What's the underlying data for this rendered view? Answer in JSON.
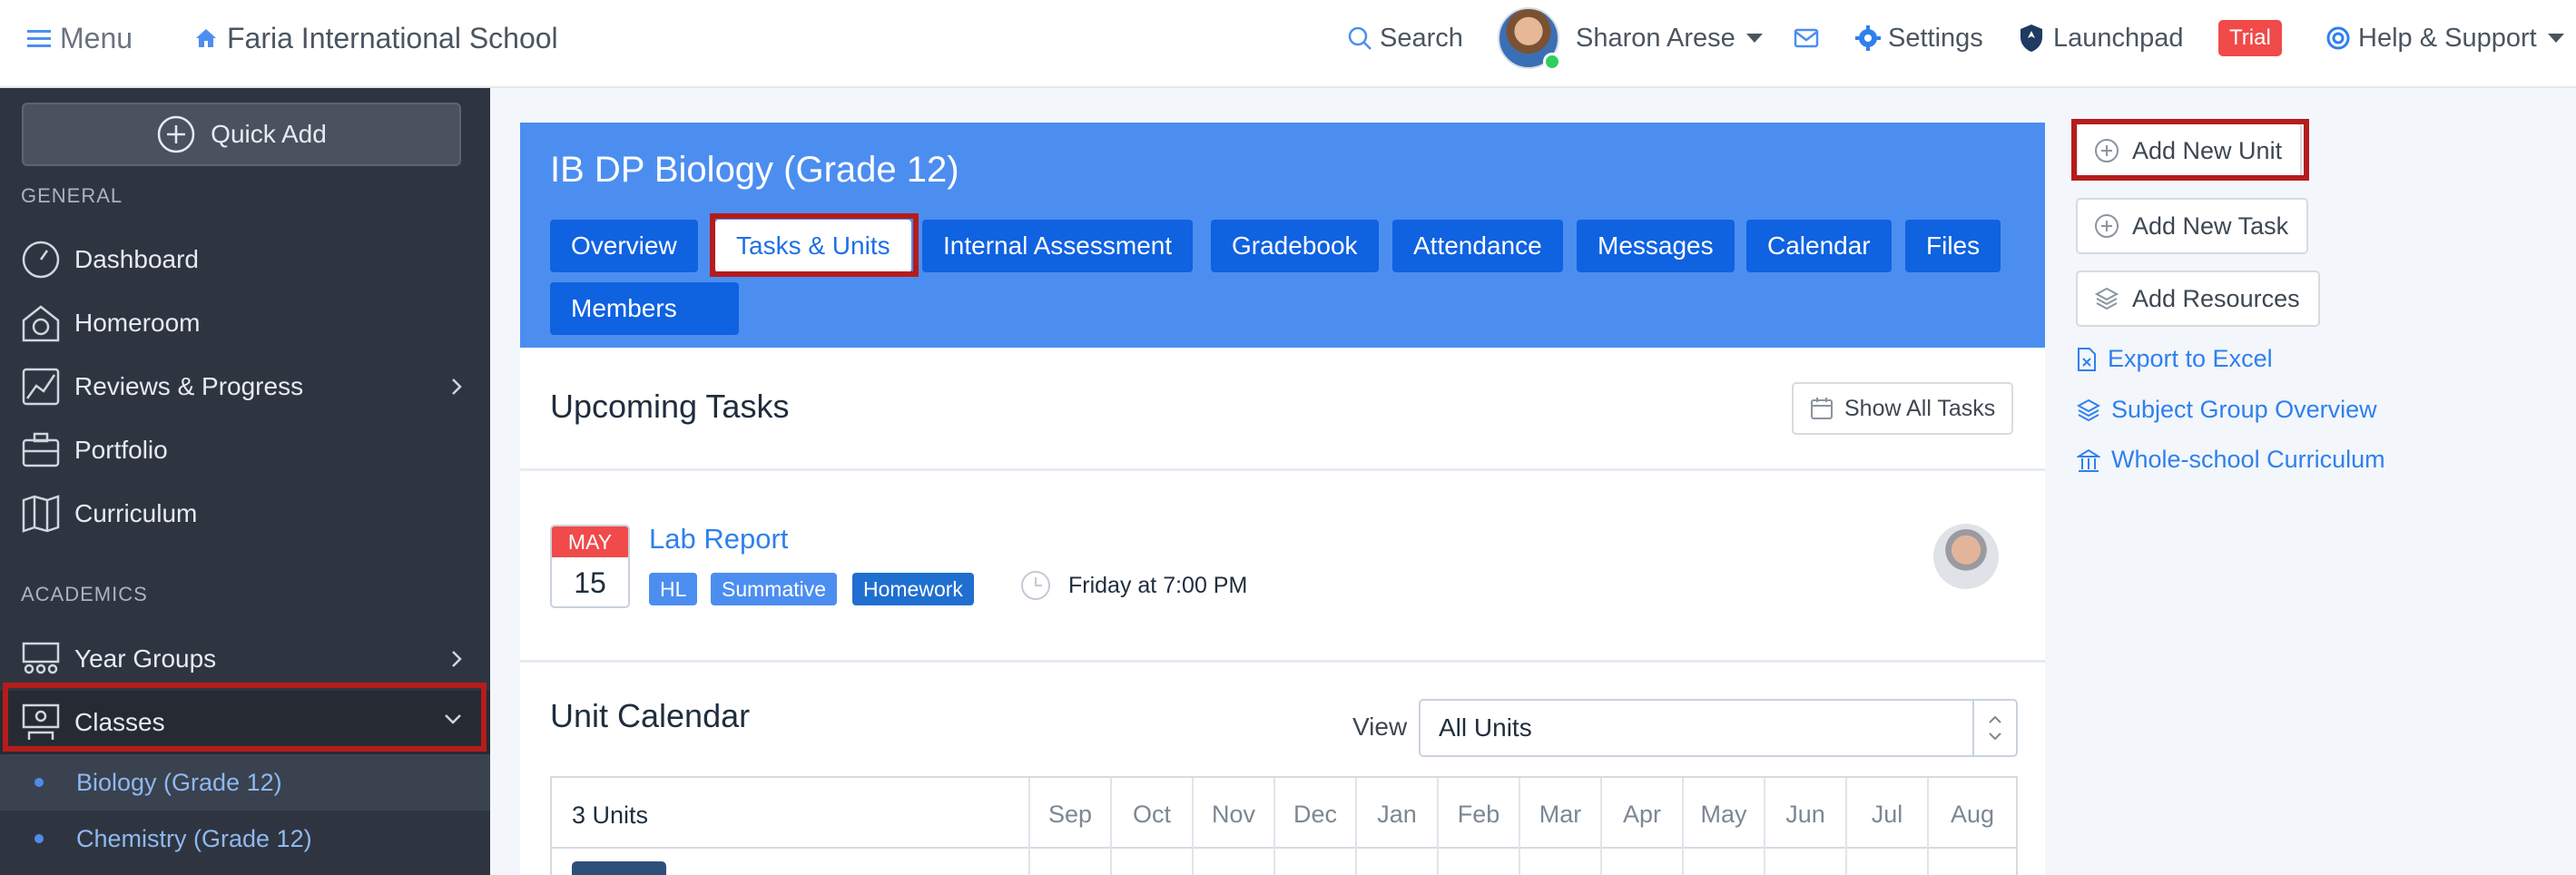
{
  "topbar": {
    "menu_label": "Menu",
    "school_name": "Faria International School",
    "search_label": "Search",
    "user_name": "Sharon Arese",
    "settings_label": "Settings",
    "launchpad_label": "Launchpad",
    "trial_label": "Trial",
    "help_label": "Help & Support"
  },
  "sidebar": {
    "quick_add": "Quick Add",
    "general_label": "GENERAL",
    "general_items": [
      {
        "label": "Dashboard",
        "icon": "dashboard-icon"
      },
      {
        "label": "Homeroom",
        "icon": "homeroom-icon"
      },
      {
        "label": "Reviews & Progress",
        "icon": "reviews-chart-icon"
      },
      {
        "label": "Portfolio",
        "icon": "portfolio-icon"
      },
      {
        "label": "Curriculum",
        "icon": "curriculum-map-icon"
      }
    ],
    "academics_label": "ACADEMICS",
    "academic_items": [
      {
        "label": "Year Groups",
        "icon": "year-groups-icon"
      },
      {
        "label": "Classes",
        "icon": "classes-icon"
      }
    ],
    "class_items": [
      {
        "label": "Biology (Grade 12)"
      },
      {
        "label": "Chemistry (Grade 12)"
      }
    ]
  },
  "course": {
    "title": "IB DP Biology (Grade 12)",
    "tabs": [
      {
        "label": "Overview"
      },
      {
        "label": "Tasks & Units"
      },
      {
        "label": "Internal Assessment"
      },
      {
        "label": "Gradebook"
      },
      {
        "label": "Attendance"
      },
      {
        "label": "Messages"
      },
      {
        "label": "Calendar"
      },
      {
        "label": "Files"
      },
      {
        "label": "Members"
      }
    ],
    "selected_tab": "Tasks & Units"
  },
  "upcoming": {
    "title": "Upcoming Tasks",
    "show_all": "Show All Tasks",
    "task": {
      "month": "MAY",
      "day": "15",
      "title": "Lab Report",
      "tags": [
        {
          "label": "HL",
          "color": "#4c8ef0"
        },
        {
          "label": "Summative",
          "color": "#4c8ef0"
        },
        {
          "label": "Homework",
          "color": "#1f6fd0"
        }
      ],
      "due": "Friday at 7:00 PM"
    }
  },
  "unit_calendar": {
    "title": "Unit Calendar",
    "view_label": "View",
    "view_value": "All Units",
    "units_count": "3 Units",
    "months": [
      "Sep",
      "Oct",
      "Nov",
      "Dec",
      "Jan",
      "Feb",
      "Mar",
      "Apr",
      "May",
      "Jun",
      "Jul",
      "Aug"
    ]
  },
  "right_panel": {
    "add_unit": "Add New Unit",
    "add_task": "Add New Task",
    "add_resources": "Add Resources",
    "export": "Export to Excel",
    "subject_overview": "Subject Group Overview",
    "whole_school": "Whole-school Curriculum"
  },
  "colors": {
    "accent": "#4c8ef0",
    "tab": "#0f62e0",
    "sidebar": "#2f3540",
    "highlight": "#b51c1c",
    "link": "#2f80ed"
  }
}
